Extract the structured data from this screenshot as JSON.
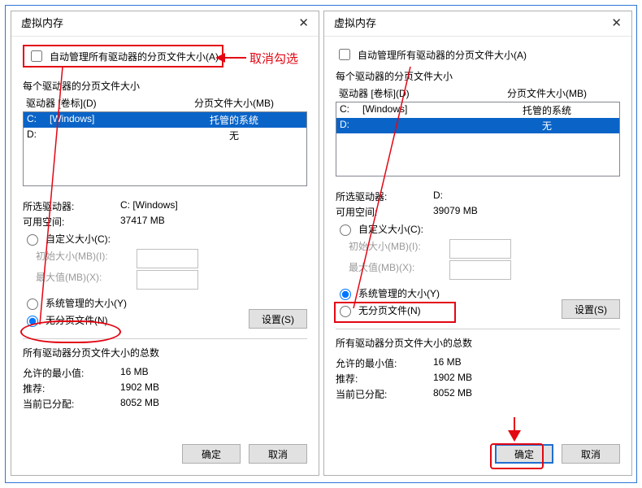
{
  "annotation_text": "取消勾选",
  "left": {
    "title": "虚拟内存",
    "auto_label": "自动管理所有驱动器的分页文件大小(A)",
    "per_drive_heading": "每个驱动器的分页文件大小",
    "col_drive": "驱动器 [卷标](D)",
    "col_paging": "分页文件大小(MB)",
    "rows": [
      {
        "drive": "C:",
        "vol": "[Windows]",
        "paging": "托管的系统",
        "selected": true
      },
      {
        "drive": "D:",
        "vol": "",
        "paging": "无",
        "selected": false
      }
    ],
    "selected_drive_label": "所选驱动器:",
    "selected_drive_value": "C:  [Windows]",
    "free_label": "可用空间:",
    "free_value": "37417 MB",
    "radio_custom": "自定义大小(C):",
    "initial_label": "初始大小(MB)(I):",
    "max_label": "最大值(MB)(X):",
    "radio_system": "系统管理的大小(Y)",
    "radio_none": "无分页文件(N)",
    "set_btn": "设置(S)",
    "totals_heading": "所有驱动器分页文件大小的总数",
    "allowed_min_label": "允许的最小值:",
    "allowed_min_value": "16 MB",
    "rec_label": "推荐:",
    "rec_value": "1902 MB",
    "cur_label": "当前已分配:",
    "cur_value": "8052 MB",
    "ok": "确定",
    "cancel": "取消",
    "selected_radio": "none"
  },
  "right": {
    "title": "虚拟内存",
    "auto_label": "自动管理所有驱动器的分页文件大小(A)",
    "per_drive_heading": "每个驱动器的分页文件大小",
    "col_drive": "驱动器 [卷标](D)",
    "col_paging": "分页文件大小(MB)",
    "rows": [
      {
        "drive": "C:",
        "vol": "[Windows]",
        "paging": "托管的系统",
        "selected": false
      },
      {
        "drive": "D:",
        "vol": "",
        "paging": "无",
        "selected": true
      }
    ],
    "selected_drive_label": "所选驱动器:",
    "selected_drive_value": "D:",
    "free_label": "可用空间:",
    "free_value": "39079 MB",
    "radio_custom": "自定义大小(C):",
    "initial_label": "初始大小(MB)(I):",
    "max_label": "最大值(MB)(X):",
    "radio_system": "系统管理的大小(Y)",
    "radio_none": "无分页文件(N)",
    "set_btn": "设置(S)",
    "totals_heading": "所有驱动器分页文件大小的总数",
    "allowed_min_label": "允许的最小值:",
    "allowed_min_value": "16 MB",
    "rec_label": "推荐:",
    "rec_value": "1902 MB",
    "cur_label": "当前已分配:",
    "cur_value": "8052 MB",
    "ok": "确定",
    "cancel": "取消",
    "selected_radio": "system"
  }
}
